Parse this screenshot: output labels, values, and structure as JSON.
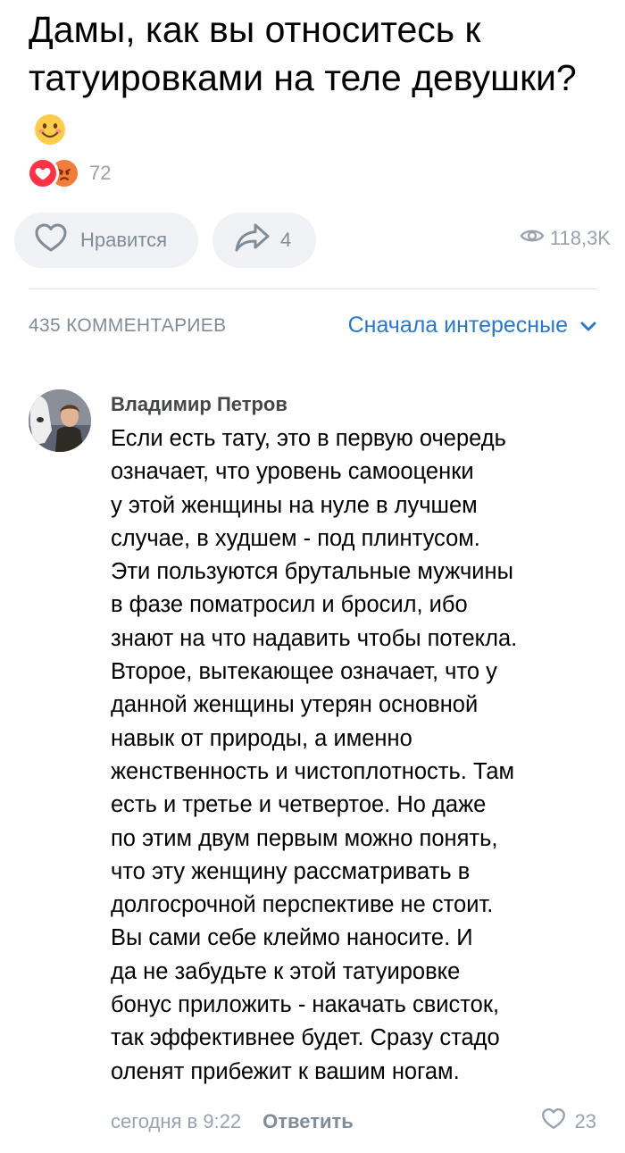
{
  "post": {
    "title": "Дамы, как вы относитесь к татуировками на теле девушки?",
    "title_emoji": "smiling-face-emoji",
    "reactions": {
      "icons": [
        "heart-reaction-icon",
        "angry-face-reaction-icon"
      ],
      "count": "72"
    },
    "like_button": {
      "label": "Нравится",
      "icon": "heart-outline-icon"
    },
    "share_button": {
      "count": "4",
      "icon": "share-arrow-icon"
    },
    "views": {
      "count": "118,3K",
      "icon": "eye-icon"
    }
  },
  "comments": {
    "count_label": "435 КОММЕНТАРИЕВ",
    "sort": {
      "selected": "Сначала интересные",
      "icon": "chevron-down-icon"
    },
    "items": [
      {
        "author": "Владимир Петров",
        "text": "Если есть тату, это в первую очередь\nозначает, что уровень самооценки\nу этой женщины на нуле в лучшем\nслучае, в худшем - под плинтусом.\nЭти пользуются брутальные мужчины\nв фазе поматросил и бросил, ибо\nзнают на что надавить чтобы потекла.\nВторое, вытекающее означает, что у\nданной женщины утерян основной\nнавык от природы, а именно\nженственность и чистоплотность. Там\nесть и третье и четвертое. Но даже\nпо этим двум первым можно понять,\nчто эту женщину рассматривать в\nдолгосрочной перспективе не стоит.\nВы сами себе клеймо наносите. И\nда не забудьте к этой татуировке\nбонус приложить - накачать свисток,\nтак эффективнее будет. Сразу стадо\nоленят прибежит к вашим ногам.",
        "time": "сегодня в 9:22",
        "reply_label": "Ответить",
        "likes": "23"
      }
    ]
  },
  "colors": {
    "accent": "#2a78c8",
    "secondary_text": "#818c99",
    "button_bg": "#f0f2f5",
    "heart_reaction": "#ff3347",
    "angry_reaction": "#f27c3a"
  }
}
